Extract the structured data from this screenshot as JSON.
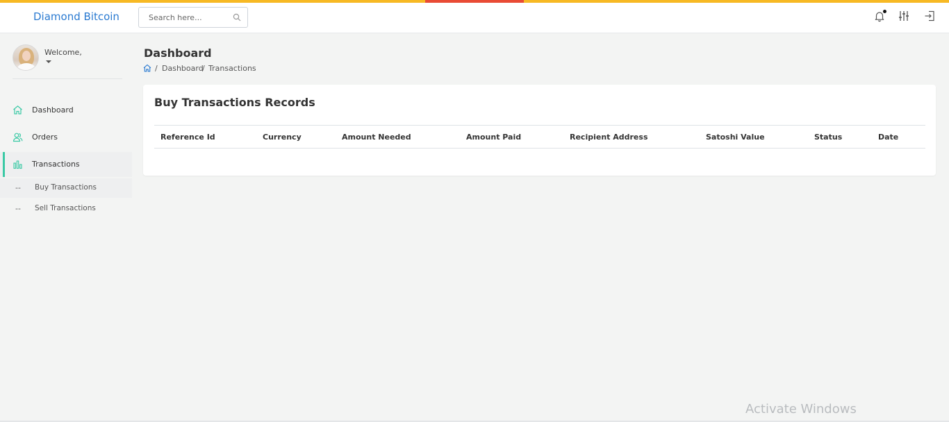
{
  "app": {
    "brand": "Diamond Bitcoin",
    "accent_color": "#f7b924",
    "accent_red": "#e94b35",
    "brand_color": "#2a7ad1"
  },
  "search": {
    "placeholder": "Search here...",
    "value": ""
  },
  "topbar_icons": [
    "bell-icon",
    "sliders-icon",
    "logout-icon"
  ],
  "profile": {
    "welcome": "Welcome,"
  },
  "sidebar": {
    "items": [
      {
        "label": "Dashboard",
        "icon": "home-icon"
      },
      {
        "label": "Orders",
        "icon": "users-icon"
      },
      {
        "label": "Transactions",
        "icon": "bar-chart-icon",
        "active": true
      }
    ],
    "subitems": [
      {
        "dash": "--",
        "label": "Buy Transactions",
        "active": true
      },
      {
        "dash": "--",
        "label": "Sell Transactions"
      }
    ]
  },
  "page": {
    "title": "Dashboard",
    "breadcrumb": [
      "Dashboard",
      "Transactions"
    ],
    "separator": "/"
  },
  "card": {
    "title": "Buy Transactions Records",
    "columns": [
      "Reference Id",
      "Currency",
      "Amount Needed",
      "Amount Paid",
      "Recipient Address",
      "Satoshi Value",
      "Status",
      "Date"
    ],
    "rows": []
  },
  "watermark": "Activate Windows"
}
